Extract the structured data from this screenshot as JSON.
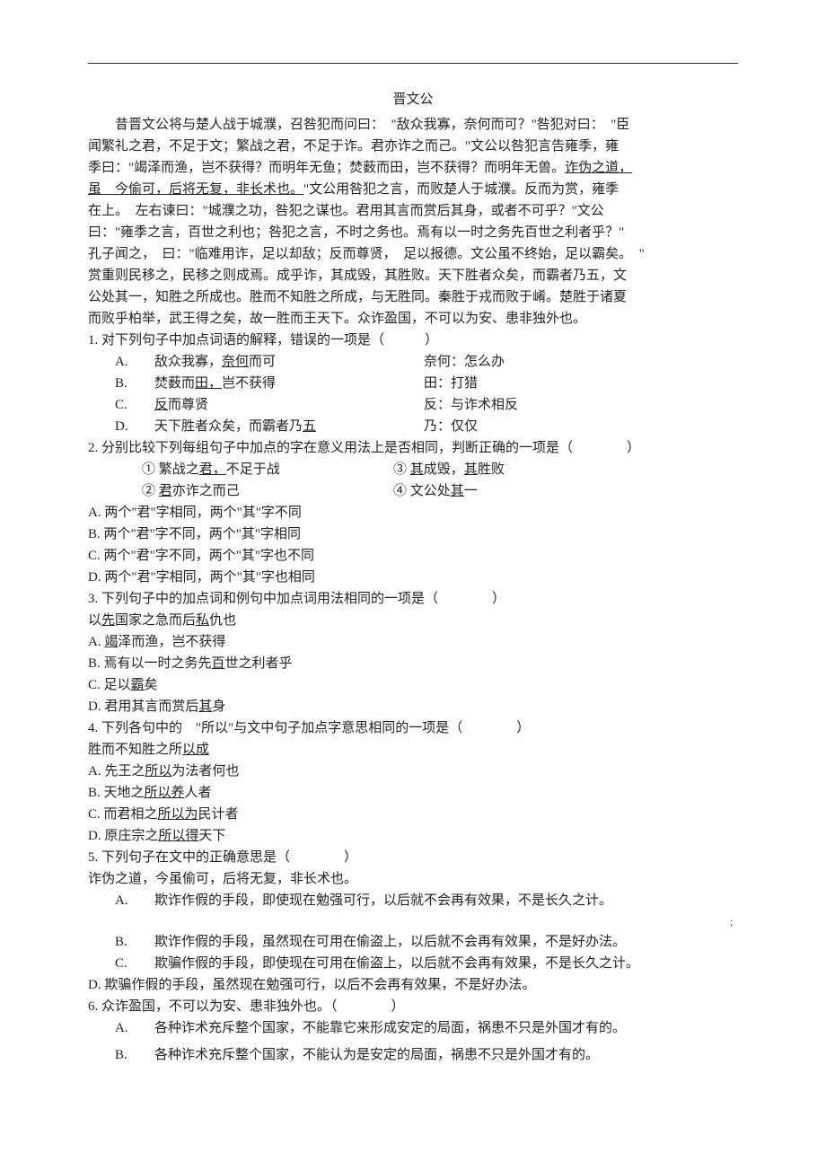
{
  "title": "晋文公",
  "passage": {
    "p1a": "昔晋文公将与楚人战于城濮，召咎犯而问曰：　\"敌众我寡，奈何而可？\"咎犯对曰：　\"臣",
    "p1b": "闻繁礼之君，不足于文；繁战之君，不足于诈。君亦诈之而己。\"文公以咎犯言告雍季，雍",
    "p1c": "季曰：\"竭泽而渔，岂不获得？而明年无鱼；焚薮而田，岂不获得？而明年无兽。",
    "p1c_u": "诈伪之道，",
    "p1d_u": "虽　今偷可，后将无复，非长术也。",
    "p1d_rest": "\"文公用咎犯之言，而败楚人于城濮。反而为赏，雍季",
    "p1e": "在上。　左右谏曰：\"城濮之功，咎犯之谋也。君用其言而赏后其身，或者不可乎？\"文公",
    "p1f": "曰：\"雍季之言，百世之利也；咎犯之言，不时之务也。焉有以一时之务先百世之利者乎？\"",
    "p1g": "孔子闻之，　曰：\"临难用诈，足以却敌；反而尊贤，　足以报德。文公虽不终始，足以霸矣。　\"",
    "p1h": "赏重则民移之，民移之则成焉。成乎诈，其成毁，其胜败。天下胜者众矣，而霸者乃五，文",
    "p1i": "公处其一，知胜之所成也。胜而不知胜之所成，与无胜同。秦胜于戎而败于崤。楚胜于诸夏",
    "p1j": "而败乎柏举，武王得之矣，故一胜而王天下。众诈盈国，不可以为安、患非独外也。"
  },
  "q1": {
    "stem": "1.  对下列句子中加点词语的解释，错误的一项是（　　　）",
    "A_l": "A.",
    "A_mid_pre": "敌众我寡，",
    "A_mid_u": "奈何",
    "A_mid_post": "而可",
    "A_right": "奈何：怎么办",
    "B_l": "B.",
    "B_mid_pre": "焚薮而",
    "B_mid_u": "田，",
    "B_mid_post": "岂不获得",
    "B_right": "田：打猎",
    "C_l": "C.",
    "C_mid_u": "反",
    "C_mid_post": "而尊贤",
    "C_right": "反：与诈术相反",
    "D_l": "D.",
    "D_mid_pre": "天下胜者众矣，而霸者乃",
    "D_mid_u": "五",
    "D_right": "乃：仅仅"
  },
  "q2": {
    "stem": "2.  分别比较下列每组句子中加点的字在意义用法上是否相同，判断正确的一项是（　　　　）",
    "l1a_pre": "① 繁战之",
    "l1a_u": "君，",
    "l1a_post": "不足于战",
    "l1b_u": "其",
    "l1b_pre": "③ ",
    "l1b_mid": "成毁，",
    "l1b_u2": "其",
    "l1b_post": "胜败",
    "l2a_pre": "② ",
    "l2a_u": "君",
    "l2a_post": "亦诈之而己",
    "l2b_pre": "④ 文公处",
    "l2b_u": "其",
    "l2b_post": "一",
    "A": "A. 两个\"君\"字相同，两个\"其\"字不同",
    "B": "B. 两个\"君\"字不同，两个\"其\"字相同",
    "C": "C. 两个\"君\"字不同，两个\"其\"字也不同",
    "D": "D. 两个\"君\"字相同，两个\"其\"字也相同"
  },
  "q3": {
    "stem": "3.  下列句子中的加点词和例句中加点词用法相同的一项是（　　　　）",
    "ex_pre": "以",
    "ex_u1": "先",
    "ex_mid": "国家之急而后",
    "ex_u2": "私",
    "ex_post": "仇也",
    "A_pre": "A. ",
    "A_u": "竭",
    "A_post": "泽而渔，岂不获得",
    "B_pre": "B. 焉有以一时之务先",
    "B_u": "百",
    "B_post": "世之利者乎",
    "C_pre": "C. 足以",
    "C_u": "霸",
    "C_post": "矣",
    "D_pre": "D. 君用其言而赏后",
    "D_u": "其",
    "D_post": "身"
  },
  "q4": {
    "stem": "4.  下列各句中的　\"所以\"与文中句子加点字意思相同的一项是（　　　　）",
    "ex_pre": "胜而不知胜之所",
    "ex_u": "以成",
    "A_pre": "A. 先王之",
    "A_u": "所以",
    "A_post": "为法者何也",
    "B_pre": "B. 天地之",
    "B_u": "所以养",
    "B_post": "人者",
    "C_pre": "C. 而君相之",
    "C_u": "所以为",
    "C_post": "民计者",
    "D_pre": "D. 原庄宗之",
    "D_u": "所以得",
    "D_post": "天下"
  },
  "q5": {
    "stem": "5.  下列句子在文中的正确意思是（　　　　）",
    "ex": "诈伪之道，今虽偷可，后将无复，非长术也。",
    "A_l": "A.",
    "A_r": "欺诈作假的手段，即使现在勉强可行，以后就不会再有效果，不是长久之计。",
    "B_l": "B.",
    "B_r": "欺诈作假的手段，虽然现在可用在偷盗上，以后就不会再有效果，不是好办法。",
    "C_l": "C.",
    "C_r": "欺骗作假的手段，即使现在可用在偷盗上，以后就不会再有效果，不是长久之计。",
    "D": "D. 欺骗作假的手段，虽然现在勉强可行，以后不会再有效果，不是好办法。"
  },
  "q6": {
    "stem": "6. 众诈盈国，不可以为安、患非独外也。（　　　　）",
    "A_l": "A.",
    "A_r": "各种诈术充斥整个国家，不能靠它来形成安定的局面，祸患不只是外国才有的。",
    "B_l": "B.",
    "B_r": "各种诈术充斥整个国家，不能认为是安定的局面，祸患不只是外国才有的。"
  },
  "note": "；"
}
